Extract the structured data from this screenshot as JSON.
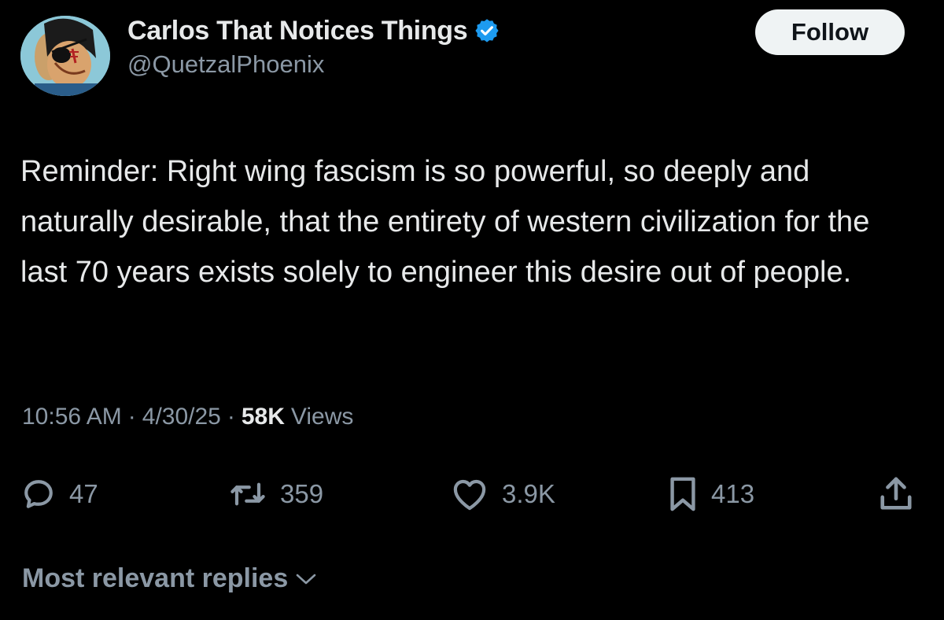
{
  "author": {
    "display_name": "Carlos That Notices Things",
    "handle": "@QuetzalPhoenix",
    "verified": true
  },
  "follow_label": "Follow",
  "tweet": {
    "text": "Reminder: Right wing fascism is so powerful, so deeply and naturally desirable, that the entirety of western civilization for the last 70 years exists solely to engineer this desire out of people."
  },
  "meta": {
    "time": "10:56 AM",
    "separator": "·",
    "date": "4/30/25",
    "views_count": "58K",
    "views_label": "Views"
  },
  "actions": {
    "replies": "47",
    "reposts": "359",
    "likes": "3.9K",
    "bookmarks": "413"
  },
  "replies_sort_label": "Most relevant replies",
  "colors": {
    "background": "#000000",
    "primary_text": "#e7e9ea",
    "secondary_text": "#8b98a5",
    "verified_blue": "#1d9bf0",
    "follow_button_bg": "#eff3f4"
  }
}
